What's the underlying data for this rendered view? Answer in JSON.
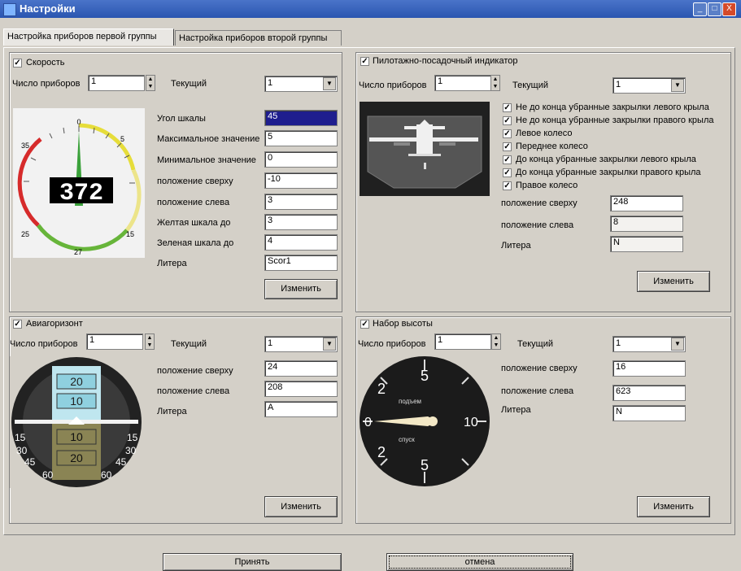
{
  "window": {
    "title": "Настройки",
    "minimize": "_",
    "maximize": "□",
    "close": "X"
  },
  "tabs": [
    "Настройка приборов первой группы",
    "Настройка приборов второй группы"
  ],
  "speed": {
    "checked": true,
    "title": "Скорость",
    "count_label": "Число приборов",
    "count_value": "1",
    "current_label": "Текущий",
    "current_value": "1",
    "fields": [
      {
        "label": "Угол шкалы",
        "value": "45"
      },
      {
        "label": "Максимальное значение",
        "value": "5"
      },
      {
        "label": "Минимальное значение",
        "value": "0"
      },
      {
        "label": "положение сверху",
        "value": "-10"
      },
      {
        "label": "положение слева",
        "value": "3"
      },
      {
        "label": "Желтая шкала до",
        "value": "3"
      },
      {
        "label": "Зеленая шкала до",
        "value": "4"
      },
      {
        "label": "Литера",
        "value": "Scor1"
      }
    ],
    "button": "Изменить",
    "gauge": {
      "display": "372",
      "tick_0": "0",
      "tick_5": "5",
      "tick_35": "35",
      "tick_25": "25",
      "tick_15": "15",
      "tick_27": "27"
    }
  },
  "pfd": {
    "checked": true,
    "title": "Пилотажно-посадочный индикатор",
    "count_label": "Число приборов",
    "count_value": "1",
    "current_label": "Текущий",
    "current_value": "1",
    "checks": [
      "Не до конца убранные закрылки левого крыла",
      "Не до конца убранные закрылки правого крыла",
      "Левое колесо",
      "Переднее колесо",
      "До конца убранные закрылки левого крыла",
      "До конца убранные закрылки правого крыла",
      "Правое колесо"
    ],
    "fields": [
      {
        "label": "положение сверху",
        "value": "248"
      },
      {
        "label": "положение слева",
        "value": "8"
      },
      {
        "label": "Литера",
        "value": "N"
      }
    ],
    "button": "Изменить"
  },
  "horizon": {
    "checked": true,
    "title": "Авиагоризонт",
    "count_label": "Число приборов",
    "count_value": "1",
    "current_label": "Текущий",
    "current_value": "1",
    "fields": [
      {
        "label": "положение сверху",
        "value": "24"
      },
      {
        "label": "положение слева",
        "value": "208"
      },
      {
        "label": "Литера",
        "value": "A"
      }
    ],
    "button": "Изменить",
    "gauge": {
      "p20": "20",
      "p10": "10",
      "m10": "10",
      "m20": "20",
      "b15": "15",
      "b30": "30",
      "b45": "45",
      "b60": "60"
    }
  },
  "climb": {
    "checked": true,
    "title": "Набор высоты",
    "count_label": "Число приборов",
    "count_value": "1",
    "current_label": "Текущий",
    "current_value": "1",
    "fields": [
      {
        "label": "положение сверху",
        "value": "16"
      },
      {
        "label": "положение слева",
        "value": "623"
      },
      {
        "label": "Литера",
        "value": "N"
      }
    ],
    "button": "Изменить",
    "gauge": {
      "t5": "5",
      "b5": "5",
      "l2": "2",
      "l2b": "2",
      "zero": "0",
      "ten": "10",
      "up": "подъем",
      "down": "спуск"
    }
  },
  "footer": {
    "accept": "Принять",
    "cancel": "отмена"
  }
}
